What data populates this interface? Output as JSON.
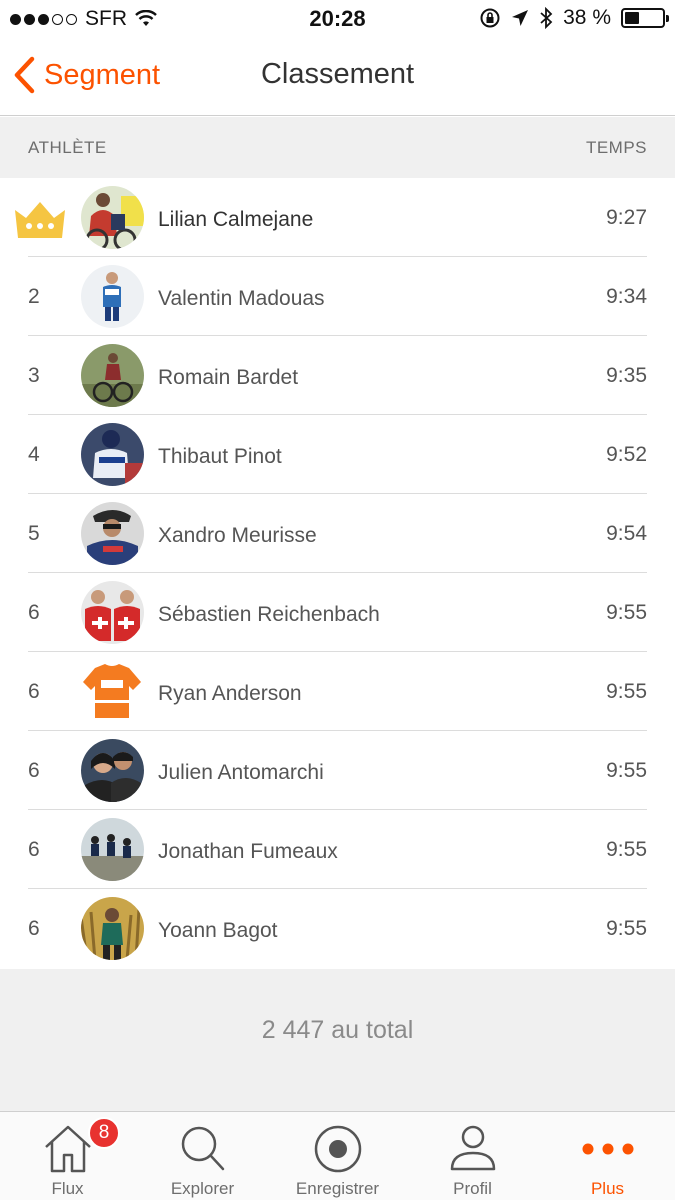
{
  "status_bar": {
    "carrier": "SFR",
    "time": "20:28",
    "battery": "38 %",
    "battery_level": 0.38
  },
  "nav": {
    "back_label": "Segment",
    "title": "Classement"
  },
  "table_header": {
    "athlete": "ATHLÈTE",
    "time": "TEMPS"
  },
  "leaderboard": [
    {
      "rank": "",
      "name": "Lilian Calmejane",
      "time": "9:27",
      "is_leader": true
    },
    {
      "rank": "2",
      "name": "Valentin Madouas",
      "time": "9:34"
    },
    {
      "rank": "3",
      "name": "Romain Bardet",
      "time": "9:35"
    },
    {
      "rank": "4",
      "name": "Thibaut Pinot",
      "time": "9:52"
    },
    {
      "rank": "5",
      "name": "Xandro Meurisse",
      "time": "9:54"
    },
    {
      "rank": "6",
      "name": "Sébastien Reichenbach",
      "time": "9:55"
    },
    {
      "rank": "6",
      "name": "Ryan Anderson",
      "time": "9:55"
    },
    {
      "rank": "6",
      "name": "Julien Antomarchi",
      "time": "9:55"
    },
    {
      "rank": "6",
      "name": "Jonathan Fumeaux",
      "time": "9:55"
    },
    {
      "rank": "6",
      "name": "Yoann Bagot",
      "time": "9:55"
    }
  ],
  "total_label": "2 447 au total",
  "tabs": [
    {
      "label": "Flux",
      "icon": "home-icon",
      "badge": "8"
    },
    {
      "label": "Explorer",
      "icon": "search-icon"
    },
    {
      "label": "Enregistrer",
      "icon": "record-icon"
    },
    {
      "label": "Profil",
      "icon": "profile-icon"
    },
    {
      "label": "Plus",
      "icon": "more-dots-icon",
      "active": true
    }
  ],
  "colors": {
    "accent": "#fc5200",
    "crown": "#f5c542",
    "badge": "#e8322f",
    "header_bg": "#f0f0f0"
  }
}
